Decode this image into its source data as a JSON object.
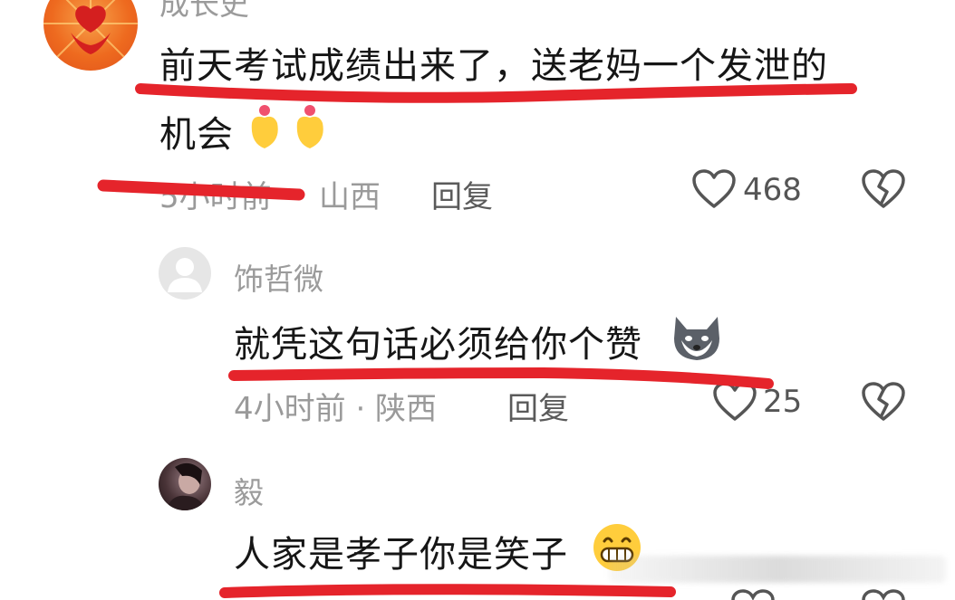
{
  "comments": [
    {
      "username": "成长史",
      "text_line1": "前天考试成绩出来了，送老妈一个发泄的",
      "text_line2": "机会",
      "time": "5小时前",
      "location": "山西",
      "reply_label": "回复",
      "likes": "468"
    },
    {
      "username": "饰哲微",
      "text": "就凭这句话必须给你个赞",
      "time_location": "4小时前 · 陕西",
      "reply_label": "回复",
      "likes": "25"
    },
    {
      "username": "毅",
      "text": "人家是孝子你是笑子"
    }
  ],
  "colors": {
    "annotation_red": "#e5242b",
    "meta_gray": "#9a9a9a",
    "text_dark": "#161616"
  },
  "icons": {
    "like": "heart-outline-icon",
    "dislike": "broken-heart-icon"
  }
}
